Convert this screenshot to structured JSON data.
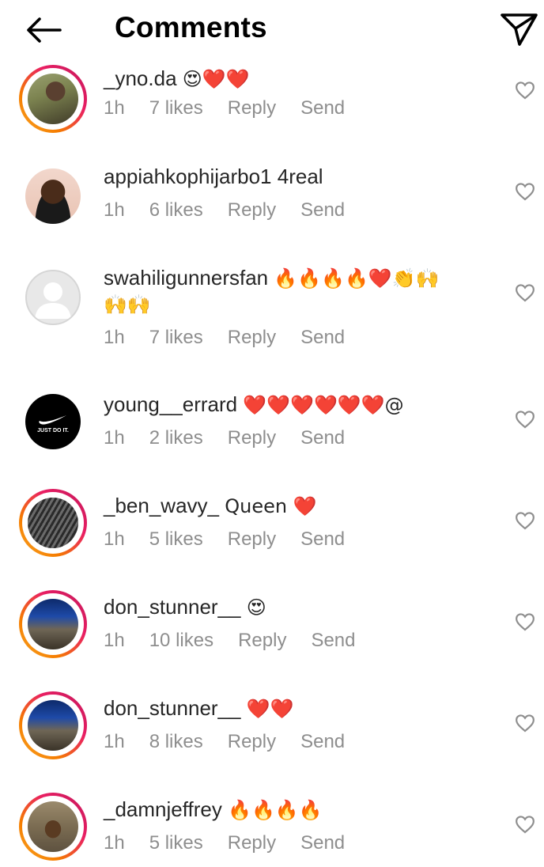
{
  "header": {
    "title": "Comments"
  },
  "comments": [
    {
      "username": "_yno.da",
      "text": "😍❤️❤️",
      "time": "1h",
      "likes": "7 likes",
      "reply": "Reply",
      "send": "Send"
    },
    {
      "username": "appiahkophijarbo1",
      "text": "4real",
      "time": "1h",
      "likes": "6 likes",
      "reply": "Reply",
      "send": "Send"
    },
    {
      "username": "swahiligunnersfan",
      "text": "🔥🔥🔥🔥❤️👏🙌",
      "text2": "🙌🙌",
      "time": "1h",
      "likes": "7 likes",
      "reply": "Reply",
      "send": "Send"
    },
    {
      "username": "young__errard",
      "text": "❤️❤️❤️❤️❤️❤️@",
      "time": "1h",
      "likes": "2 likes",
      "reply": "Reply",
      "send": "Send",
      "avatar_text": "JUST DO IT."
    },
    {
      "username": "_ben_wavy_",
      "text": "Queen ❤️",
      "time": "1h",
      "likes": "5 likes",
      "reply": "Reply",
      "send": "Send"
    },
    {
      "username": "don_stunner__",
      "text": "😍",
      "time": "1h",
      "likes": "10 likes",
      "reply": "Reply",
      "send": "Send"
    },
    {
      "username": "don_stunner__",
      "text": "❤️❤️",
      "time": "1h",
      "likes": "8 likes",
      "reply": "Reply",
      "send": "Send"
    },
    {
      "username": "_damnjeffrey",
      "text": "🔥🔥🔥🔥",
      "time": "1h",
      "likes": "5 likes",
      "reply": "Reply",
      "send": "Send"
    }
  ],
  "colors": {
    "meta_text": "#8e8e8e",
    "body_text": "#262626",
    "heart_outline": "#8e8e8e",
    "heart_red": "#e0202a"
  },
  "icons": {
    "back": "arrow-left-icon",
    "share": "paper-plane-icon",
    "like": "heart-outline-icon"
  }
}
